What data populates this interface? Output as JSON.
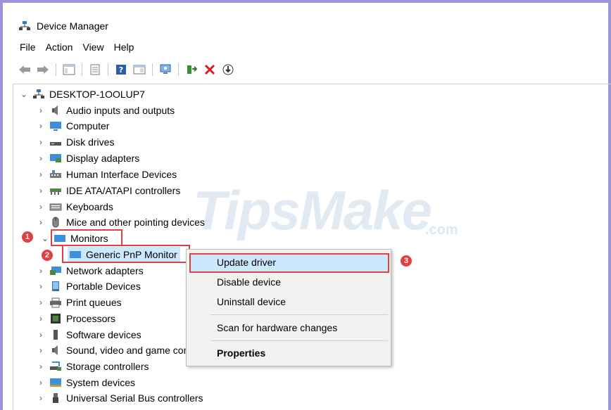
{
  "window": {
    "title": "Device Manager"
  },
  "menu": [
    "File",
    "Action",
    "View",
    "Help"
  ],
  "toolbar": {
    "icons": [
      "back-arrow-icon",
      "forward-arrow-icon",
      "show-hide-console-tree-icon",
      "properties-icon",
      "help-icon",
      "action-pane-icon",
      "scan-hardware-icon",
      "enable-device-icon",
      "uninstall-device-icon",
      "update-driver-icon"
    ]
  },
  "tree": {
    "root": "DESKTOP-1OOLUP7",
    "categories": [
      "Audio inputs and outputs",
      "Computer",
      "Disk drives",
      "Display adapters",
      "Human Interface Devices",
      "IDE ATA/ATAPI controllers",
      "Keyboards",
      "Mice and other pointing devices",
      "Monitors",
      "Network adapters",
      "Portable Devices",
      "Print queues",
      "Processors",
      "Software devices",
      "Sound, video and game controllers",
      "Storage controllers",
      "System devices",
      "Universal Serial Bus controllers"
    ],
    "expanded_child": "Generic PnP Monitor"
  },
  "context_menu": {
    "items": [
      "Update driver",
      "Disable device",
      "Uninstall device",
      "Scan for hardware changes",
      "Properties"
    ]
  },
  "callouts": [
    "1",
    "2",
    "3"
  ],
  "watermark": {
    "main": "TipsMake",
    "suffix": ".com"
  },
  "colors": {
    "highlight": "#e0403f",
    "selection": "#cce8ff",
    "frame": "#9b94d6"
  }
}
